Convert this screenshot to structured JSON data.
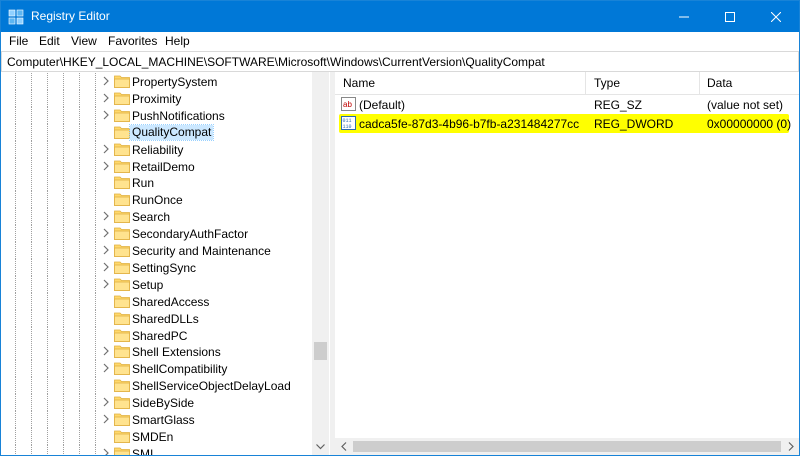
{
  "window": {
    "title": "Registry Editor"
  },
  "menu": [
    "File",
    "Edit",
    "View",
    "Favorites",
    "Help"
  ],
  "address": "Computer\\HKEY_LOCAL_MACHINE\\SOFTWARE\\Microsoft\\Windows\\CurrentVersion\\QualityCompat",
  "tree": [
    {
      "label": "PropertySystem",
      "expandable": true,
      "selected": false
    },
    {
      "label": "Proximity",
      "expandable": true,
      "selected": false
    },
    {
      "label": "PushNotifications",
      "expandable": true,
      "selected": false
    },
    {
      "label": "QualityCompat",
      "expandable": false,
      "selected": true
    },
    {
      "label": "Reliability",
      "expandable": true,
      "selected": false
    },
    {
      "label": "RetailDemo",
      "expandable": true,
      "selected": false
    },
    {
      "label": "Run",
      "expandable": false,
      "selected": false
    },
    {
      "label": "RunOnce",
      "expandable": false,
      "selected": false
    },
    {
      "label": "Search",
      "expandable": true,
      "selected": false
    },
    {
      "label": "SecondaryAuthFactor",
      "expandable": true,
      "selected": false
    },
    {
      "label": "Security and Maintenance",
      "expandable": true,
      "selected": false
    },
    {
      "label": "SettingSync",
      "expandable": true,
      "selected": false
    },
    {
      "label": "Setup",
      "expandable": true,
      "selected": false
    },
    {
      "label": "SharedAccess",
      "expandable": false,
      "selected": false
    },
    {
      "label": "SharedDLLs",
      "expandable": false,
      "selected": false
    },
    {
      "label": "SharedPC",
      "expandable": false,
      "selected": false
    },
    {
      "label": "Shell Extensions",
      "expandable": true,
      "selected": false
    },
    {
      "label": "ShellCompatibility",
      "expandable": true,
      "selected": false
    },
    {
      "label": "ShellServiceObjectDelayLoad",
      "expandable": false,
      "selected": false
    },
    {
      "label": "SideBySide",
      "expandable": true,
      "selected": false
    },
    {
      "label": "SmartGlass",
      "expandable": true,
      "selected": false
    },
    {
      "label": "SMDEn",
      "expandable": false,
      "selected": false
    },
    {
      "label": "SMI",
      "expandable": true,
      "selected": false
    }
  ],
  "columns": {
    "name": "Name",
    "type": "Type",
    "data": "Data"
  },
  "values": [
    {
      "name": "(Default)",
      "type": "REG_SZ",
      "data": "(value not set)",
      "icon": "string-value-icon",
      "highlighted": false
    },
    {
      "name": "cadca5fe-87d3-4b96-b7fb-a231484277cc",
      "type": "REG_DWORD",
      "data": "0x00000000 (0)",
      "icon": "dword-value-icon",
      "highlighted": true
    }
  ],
  "colors": {
    "titlebar": "#0078d7",
    "highlight": "#ffff00",
    "selected": "#cce8ff",
    "folder": "#ffd86b"
  }
}
